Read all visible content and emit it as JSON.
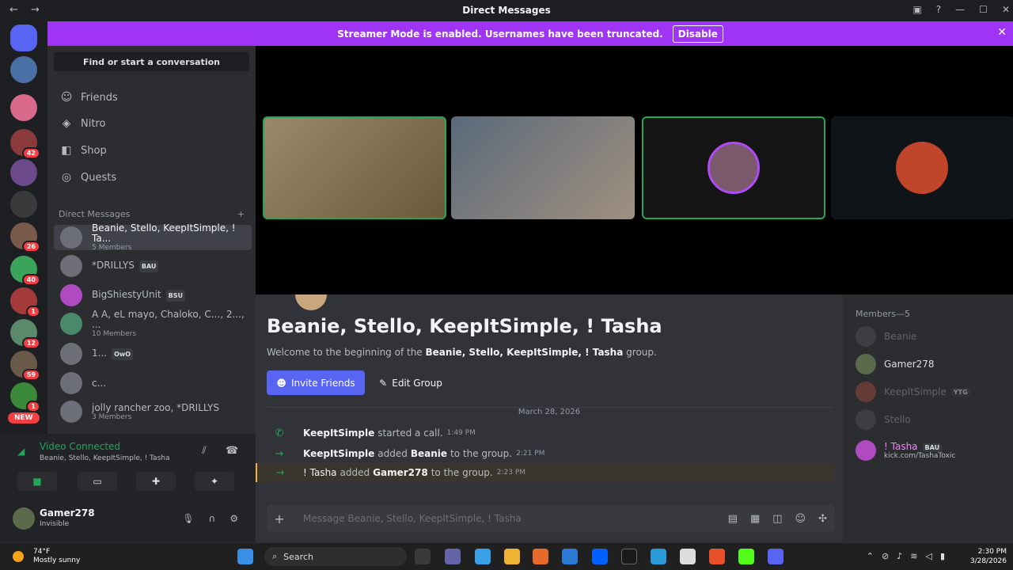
{
  "window": {
    "title": "Direct Messages",
    "back": "←",
    "forward": "→"
  },
  "banner": {
    "text": "Streamer Mode is enabled. Usernames have been truncated.",
    "disable": "Disable"
  },
  "servers": {
    "badges": [
      "42",
      "26",
      "40",
      "1",
      "12",
      "59",
      "1"
    ],
    "new_label": "NEW"
  },
  "sidebar": {
    "search": "Find or start a conversation",
    "nav": [
      {
        "label": "Friends",
        "icon": "friends-icon"
      },
      {
        "label": "Nitro",
        "icon": "nitro-icon"
      },
      {
        "label": "Shop",
        "icon": "shop-icon"
      },
      {
        "label": "Quests",
        "icon": "quests-icon"
      }
    ],
    "dm_header": "Direct Messages",
    "dms": [
      {
        "name": "Beanie, Stello, KeepItSimple, ! Ta...",
        "sub": "5 Members",
        "tag": ""
      },
      {
        "name": "*DRILLYS",
        "sub": "",
        "tag": "BAU"
      },
      {
        "name": "BigShiestyUnit",
        "sub": "",
        "tag": "BSU"
      },
      {
        "name": "A A, eL mayo, Chaloko, C..., 2..., ...",
        "sub": "10 Members",
        "tag": ""
      },
      {
        "name": "1...",
        "sub": "",
        "tag": "OwO"
      },
      {
        "name": "c...",
        "sub": "",
        "tag": ""
      },
      {
        "name": "jolly rancher zoo, *DRILLYS",
        "sub": "3 Members",
        "tag": ""
      }
    ]
  },
  "voice": {
    "status": "Video Connected",
    "channel": "Beanie, Stello, KeepItSimple, ! Tasha"
  },
  "user": {
    "name": "Gamer278",
    "status": "Invisible"
  },
  "chat": {
    "title": "Beanie, Stello, KeepItSimple, ! Tasha",
    "welcome_pre": "Welcome to the beginning of the",
    "welcome_name": "Beanie, Stello, KeepItSimple, ! Tasha",
    "welcome_post": "group.",
    "invite": "Invite Friends",
    "edit": "Edit Group",
    "date": "March 28, 2026",
    "messages": [
      {
        "actor": "KeepItSimple",
        "text": "started a call.",
        "target": "",
        "tail": "",
        "time": "1:49 PM"
      },
      {
        "actor": "KeepItSimple",
        "text": "added",
        "target": "Beanie",
        "tail": "to the group.",
        "time": "2:21 PM"
      },
      {
        "actor": "! Tasha",
        "text": "added",
        "target": "Gamer278",
        "tail": "to the group.",
        "time": "2:23 PM"
      }
    ],
    "placeholder": "Message Beanie, Stello, KeepItSimple, ! Tasha"
  },
  "members": {
    "header": "Members—5",
    "list": [
      {
        "name": "Beanie",
        "tag": ""
      },
      {
        "name": "Gamer278",
        "tag": ""
      },
      {
        "name": "KeepItSimple",
        "tag": "YTG"
      },
      {
        "name": "Stello",
        "tag": ""
      },
      {
        "name": "! Tasha",
        "tag": "BAU",
        "sub": "kick.com/TashaToxic"
      }
    ]
  },
  "taskbar": {
    "temp": "74°F",
    "weather": "Mostly sunny",
    "search": "Search",
    "time": "2:30 PM",
    "date": "3/28/2026"
  },
  "colors": {
    "accent": "#5865f2",
    "banner": "#a034f5",
    "online": "#23a55a"
  }
}
